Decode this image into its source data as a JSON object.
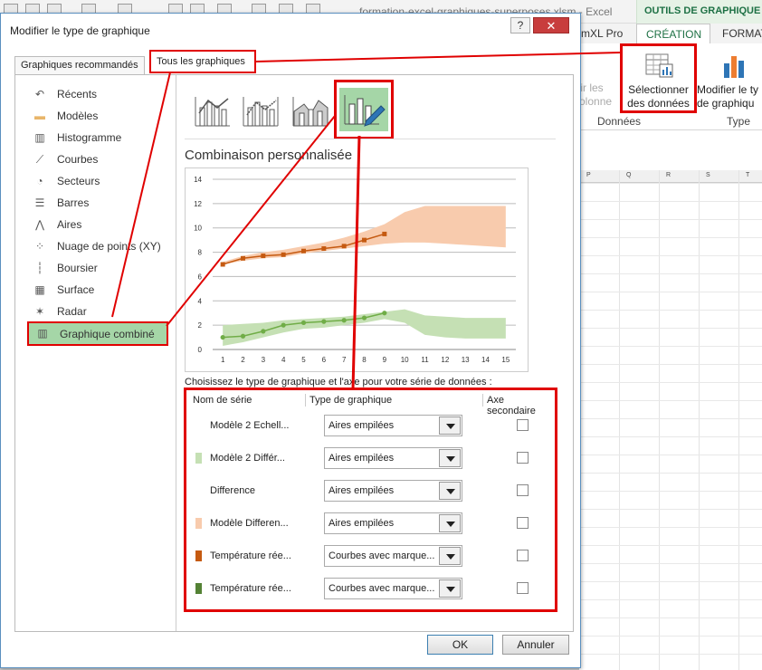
{
  "excel": {
    "window_title": "formation-excel-graphiques-superposes.xlsm - Excel",
    "tools_tab": "OUTILS DE GRAPHIQUE",
    "tabs": [
      "mXL Pro",
      "CRÉATION",
      "FORMAT"
    ],
    "ribbon": {
      "invert_label": "rtir les\ncolonne",
      "select_data": "Sélectionner\ndes données",
      "modify_type": "Modifier le ty\nde graphiqu",
      "group_data": "Données",
      "group_type": "Type"
    },
    "columns": [
      "P",
      "Q",
      "R",
      "S",
      "T"
    ]
  },
  "dialog": {
    "title": "Modifier le type de graphique",
    "help": "?",
    "close": "✕",
    "tabs": {
      "recommended": "Graphiques recommandés",
      "all": "Tous les graphiques"
    },
    "sidebar": [
      {
        "label": "Récents",
        "icon": "recent-icon"
      },
      {
        "label": "Modèles",
        "icon": "folder-icon"
      },
      {
        "label": "Histogramme",
        "icon": "column-chart-icon"
      },
      {
        "label": "Courbes",
        "icon": "line-chart-icon"
      },
      {
        "label": "Secteurs",
        "icon": "pie-chart-icon"
      },
      {
        "label": "Barres",
        "icon": "bar-chart-icon"
      },
      {
        "label": "Aires",
        "icon": "area-chart-icon"
      },
      {
        "label": "Nuage de points (XY)",
        "icon": "scatter-chart-icon"
      },
      {
        "label": "Boursier",
        "icon": "stock-chart-icon"
      },
      {
        "label": "Surface",
        "icon": "surface-chart-icon"
      },
      {
        "label": "Radar",
        "icon": "radar-chart-icon"
      },
      {
        "label": "Graphique combiné",
        "icon": "combo-chart-icon"
      }
    ],
    "combo_title": "Combinaison personnalisée",
    "series_caption": "Choisissez le type de graphique et l'axe pour votre série de données :",
    "series_headers": {
      "name": "Nom de série",
      "type": "Type de graphique",
      "axis": "Axe secondaire"
    },
    "series": [
      {
        "name": "Modèle 2 Echell...",
        "type": "Aires empilées",
        "color": "",
        "secondary": false
      },
      {
        "name": "Modèle 2 Différ...",
        "type": "Aires empilées",
        "color": "#c5e0b4",
        "secondary": false
      },
      {
        "name": "Difference",
        "type": "Aires empilées",
        "color": "",
        "secondary": false
      },
      {
        "name": "Modèle Differen...",
        "type": "Aires empilées",
        "color": "#f8cbad",
        "secondary": false
      },
      {
        "name": "Température rée...",
        "type": "Courbes avec marque...",
        "color": "#c55a11",
        "secondary": false
      },
      {
        "name": "Température rée...",
        "type": "Courbes avec marque...",
        "color": "#548235",
        "secondary": false
      }
    ],
    "buttons": {
      "ok": "OK",
      "cancel": "Annuler"
    }
  },
  "chart_data": {
    "type": "area",
    "x": [
      1,
      2,
      3,
      4,
      5,
      6,
      7,
      8,
      9,
      10,
      11,
      12,
      13,
      14,
      15
    ],
    "ylim": [
      0,
      14
    ],
    "yticks": [
      0,
      2,
      4,
      6,
      8,
      10,
      12,
      14
    ],
    "grid": true,
    "bands": [
      {
        "color": "#f8cbad",
        "lower": [
          7.0,
          7.3,
          7.5,
          7.6,
          7.9,
          8.1,
          8.3,
          8.5,
          8.7,
          8.8,
          8.8,
          8.7,
          8.6,
          8.5,
          8.4
        ],
        "upper": [
          7.2,
          7.7,
          8.0,
          8.2,
          8.5,
          8.8,
          9.2,
          9.7,
          10.3,
          11.3,
          11.8,
          11.8,
          11.8,
          11.8,
          11.8
        ]
      },
      {
        "color": "#c5e0b4",
        "lower": [
          0.3,
          0.6,
          1.0,
          1.4,
          1.7,
          1.8,
          2.0,
          2.2,
          2.5,
          2.2,
          1.2,
          1.0,
          0.9,
          0.9,
          0.9
        ],
        "upper": [
          2.0,
          2.1,
          2.2,
          2.4,
          2.5,
          2.6,
          2.7,
          2.9,
          3.1,
          3.3,
          2.8,
          2.7,
          2.6,
          2.6,
          2.6
        ]
      }
    ],
    "series": [
      {
        "color": "#c55a11",
        "marker": "square",
        "values": [
          7.0,
          7.5,
          7.7,
          7.8,
          8.1,
          8.3,
          8.5,
          9.0,
          9.5
        ]
      },
      {
        "color": "#70ad47",
        "marker": "circle",
        "values": [
          1.0,
          1.1,
          1.5,
          2.0,
          2.2,
          2.3,
          2.4,
          2.6,
          3.0
        ]
      }
    ]
  }
}
